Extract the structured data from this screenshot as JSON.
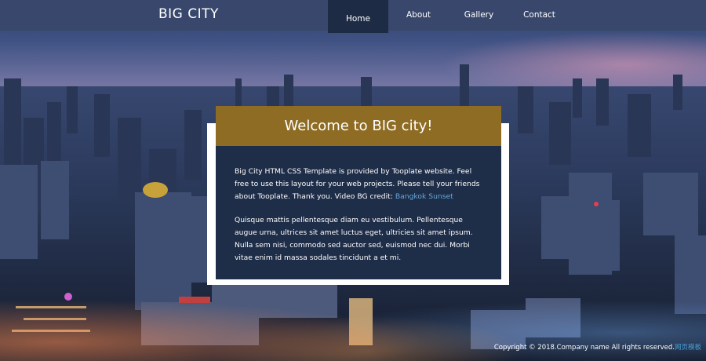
{
  "header": {
    "brand": "BIG CITY",
    "nav": [
      "Home",
      "About",
      "Gallery",
      "Contact"
    ]
  },
  "panel": {
    "title": "Welcome to BIG city!",
    "para1_text": "Big City HTML CSS Template is provided by Tooplate website. Feel free to use this layout for your web projects. Please tell your friends about Tooplate. Thank you. Video BG credit: ",
    "para1_link": "Bangkok Sunset",
    "para2": "Quisque mattis pellentesque diam eu vestibulum. Pellentesque augue urna, ultrices sit amet luctus eget, ultricies sit amet ipsum. Nulla sem nisi, commodo sed auctor sed, euismod nec dui. Morbi vitae enim id massa sodales tincidunt a et mi."
  },
  "footer": {
    "text": "Copyright © 2018.Company name All rights reserved.",
    "link": "网页模板"
  },
  "colors": {
    "navbar": "#38476b",
    "active_nav": "#1d2b45",
    "title_bar": "#8e6c24",
    "panel_body": "#1e2d48",
    "link": "#63a8d9"
  }
}
